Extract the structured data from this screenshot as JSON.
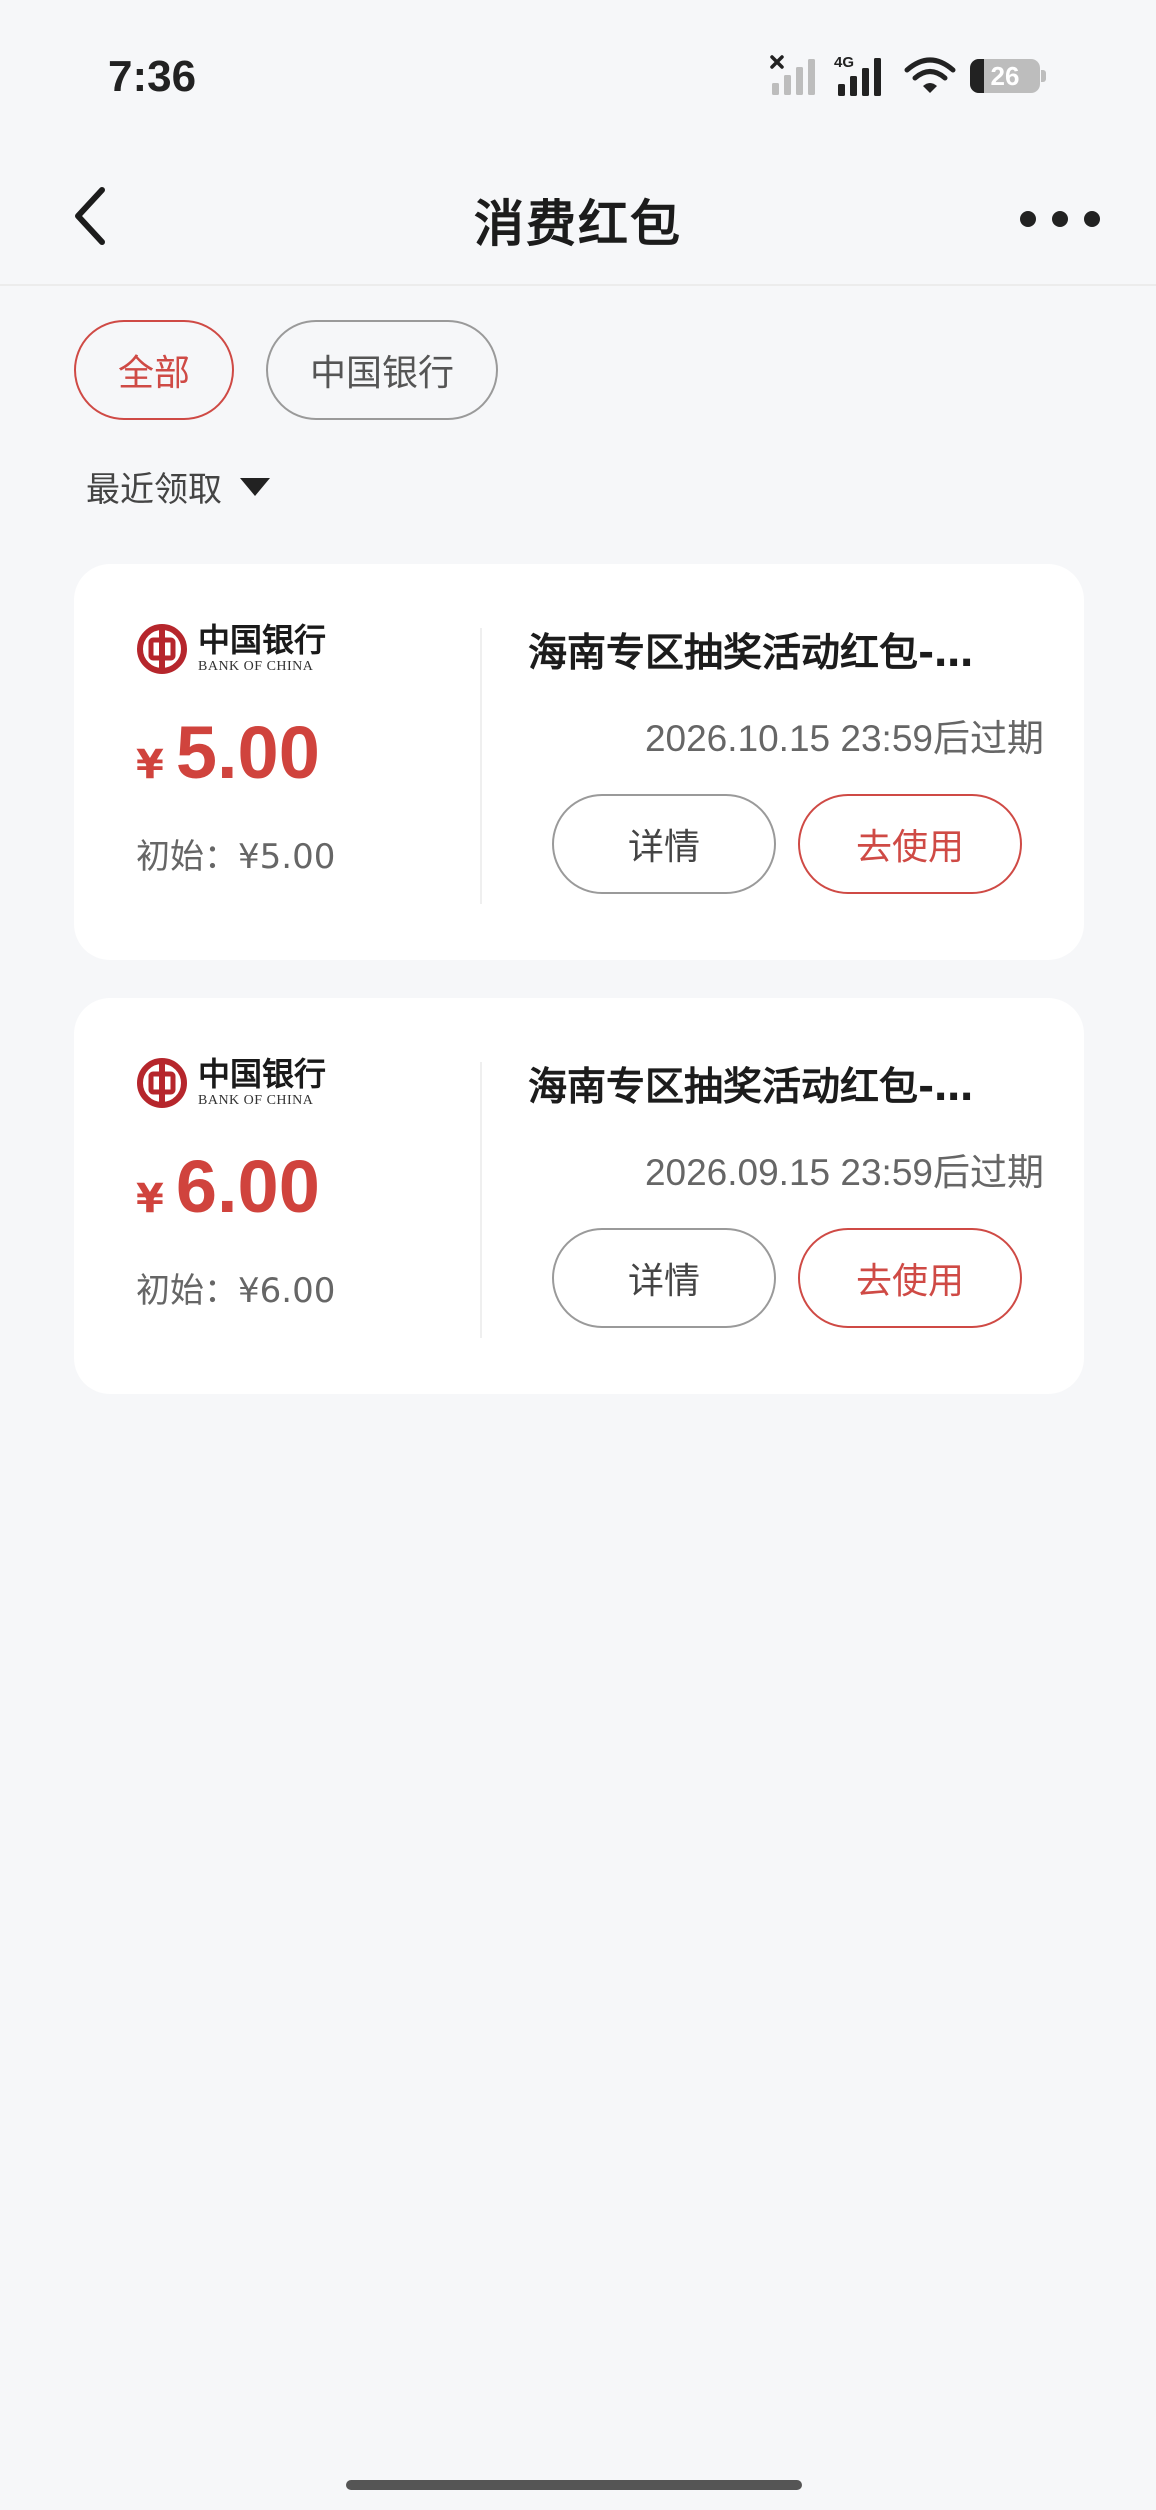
{
  "status_bar": {
    "time": "7:36",
    "network_type": "4G",
    "battery": "26",
    "icons": [
      "no-signal-sim1-icon",
      "signal-4g-icon",
      "wifi-icon",
      "battery-icon"
    ]
  },
  "header": {
    "title": "消费红包",
    "back_icon": "chevron-left-icon",
    "more_icon": "more-dots-icon"
  },
  "filters": {
    "tabs": [
      {
        "label": "全部",
        "active": true
      },
      {
        "label": "中国银行",
        "active": false
      }
    ],
    "sort_label": "最近领取"
  },
  "coupons": [
    {
      "bank_logo_cn": "中国银行",
      "bank_logo_en": "BANK OF CHINA",
      "currency": "¥",
      "amount": "5.00",
      "initial": "初始：¥5.00",
      "title": "海南专区抽奖活动红包-…",
      "expiry": "2026.10.15 23:59后过期",
      "detail_label": "详情",
      "use_label": "去使用"
    },
    {
      "bank_logo_cn": "中国银行",
      "bank_logo_en": "BANK OF CHINA",
      "currency": "¥",
      "amount": "6.00",
      "initial": "初始：¥6.00",
      "title": "海南专区抽奖活动红包-…",
      "expiry": "2026.09.15 23:59后过期",
      "detail_label": "详情",
      "use_label": "去使用"
    }
  ],
  "colors": {
    "accent": "#cf4a45",
    "background": "#f6f7f9",
    "card": "#ffffff"
  }
}
